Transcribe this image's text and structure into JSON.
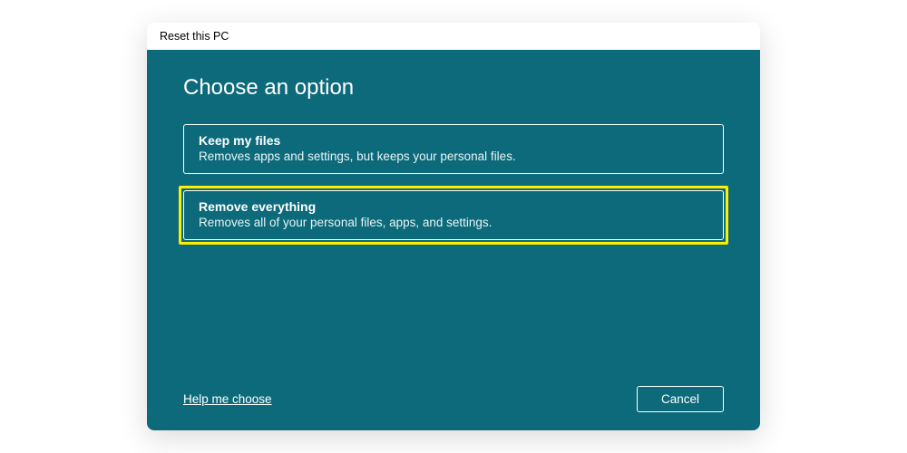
{
  "window": {
    "title": "Reset this PC"
  },
  "main": {
    "heading": "Choose an option",
    "options": [
      {
        "title": "Keep my files",
        "description": "Removes apps and settings, but keeps your personal files."
      },
      {
        "title": "Remove everything",
        "description": "Removes all of your personal files, apps, and settings."
      }
    ]
  },
  "footer": {
    "help_link": "Help me choose",
    "cancel_label": "Cancel"
  },
  "colors": {
    "accent": "#0d6a7a",
    "highlight": "#ffee00"
  }
}
